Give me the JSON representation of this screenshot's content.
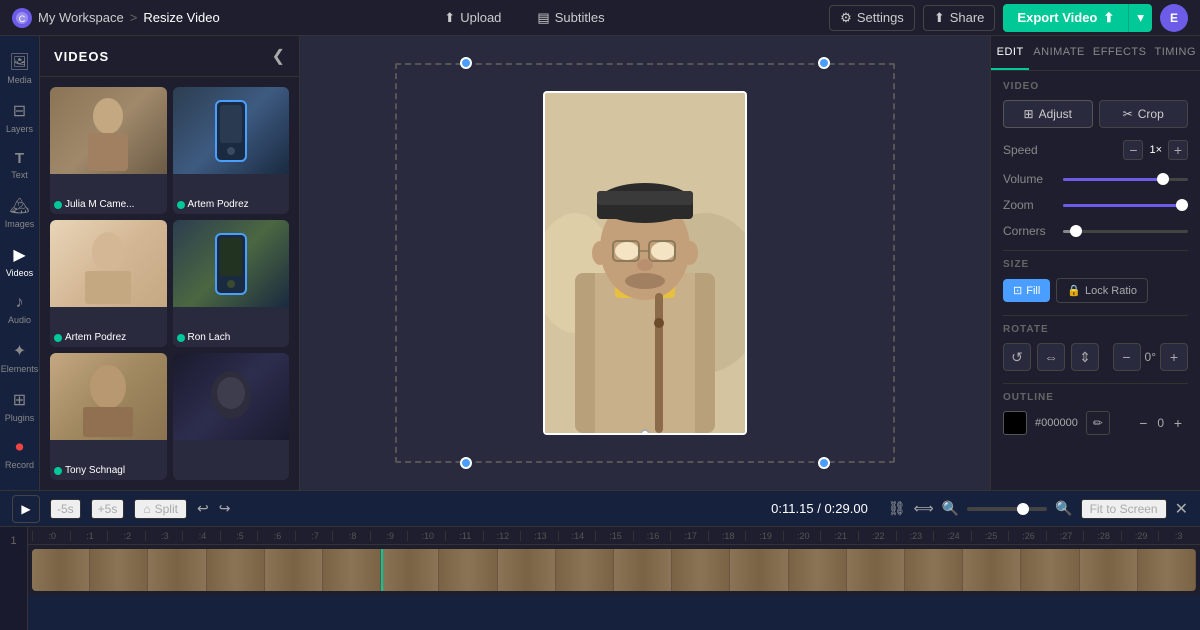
{
  "app": {
    "logo_text": "C",
    "workspace": "My Workspace",
    "separator": ">",
    "page_title": "Resize Video"
  },
  "topbar": {
    "upload_label": "Upload",
    "subtitles_label": "Subtitles",
    "settings_label": "Settings",
    "share_label": "Share",
    "export_label": "Export Video",
    "avatar_label": "E"
  },
  "media_panel": {
    "title": "VIDEOS",
    "collapse_icon": "❮",
    "videos": [
      {
        "id": 1,
        "label": "Julia M Came...",
        "has_dot": true,
        "class": "thumb-1"
      },
      {
        "id": 2,
        "label": "Artem Podrez",
        "has_dot": true,
        "class": "thumb-2"
      },
      {
        "id": 3,
        "label": "Artem Podrez",
        "has_dot": true,
        "class": "thumb-3"
      },
      {
        "id": 4,
        "label": "Ron Lach",
        "has_dot": true,
        "class": "thumb-4"
      },
      {
        "id": 5,
        "label": "Tony Schnagl",
        "has_dot": true,
        "class": "thumb-5"
      },
      {
        "id": 6,
        "label": "",
        "has_dot": false,
        "class": "thumb-6"
      }
    ]
  },
  "left_sidebar": {
    "items": [
      {
        "id": "media",
        "label": "Media",
        "icon": "🖼",
        "active": false
      },
      {
        "id": "layers",
        "label": "Layers",
        "icon": "⊟",
        "active": false
      },
      {
        "id": "text",
        "label": "Text",
        "icon": "T",
        "active": false
      },
      {
        "id": "images",
        "label": "Images",
        "icon": "🏔",
        "active": false
      },
      {
        "id": "videos",
        "label": "Videos",
        "icon": "▶",
        "active": true
      },
      {
        "id": "audio",
        "label": "Audio",
        "icon": "♪",
        "active": false
      },
      {
        "id": "elements",
        "label": "Elements",
        "icon": "✦",
        "active": false
      },
      {
        "id": "plugins",
        "label": "Plugins",
        "icon": "⊞",
        "active": false
      },
      {
        "id": "record",
        "label": "Record",
        "icon": "⏺",
        "active": false
      }
    ]
  },
  "right_panel": {
    "tabs": [
      "EDIT",
      "ANIMATE",
      "EFFECTS",
      "TIMING"
    ],
    "active_tab": "EDIT",
    "video_section_label": "VIDEO",
    "adjust_label": "Adjust",
    "crop_label": "Crop",
    "speed_label": "Speed",
    "speed_value": "1×",
    "volume_label": "Volume",
    "volume_pct": 80,
    "zoom_label": "Zoom",
    "zoom_pct": 95,
    "corners_label": "Corners",
    "corners_pct": 10,
    "size_label": "SIZE",
    "fill_label": "Fill",
    "lock_ratio_label": "Lock Ratio",
    "rotate_label": "ROTATE",
    "rotate_degree": "0°",
    "outline_label": "OUTLINE",
    "outline_color": "#000000",
    "outline_value": "0"
  },
  "timeline": {
    "play_icon": "▶",
    "minus5_label": "-5s",
    "plus5_label": "+5s",
    "split_label": "Split",
    "current_time": "0:11.15",
    "total_time": "0:29.00",
    "fit_label": "Fit to Screen",
    "ruler_marks": [
      ":0",
      ":1",
      ":2",
      ":3",
      ":4",
      ":5",
      ":6",
      ":7",
      ":8",
      ":9",
      ":10",
      ":11",
      ":12",
      ":13",
      ":14",
      ":15",
      ":16",
      ":17",
      ":18",
      ":19",
      ":20",
      ":21",
      ":22",
      ":23",
      ":24",
      ":25",
      ":26",
      ":27",
      ":28",
      ":29",
      ":3"
    ],
    "track_number": "1"
  }
}
